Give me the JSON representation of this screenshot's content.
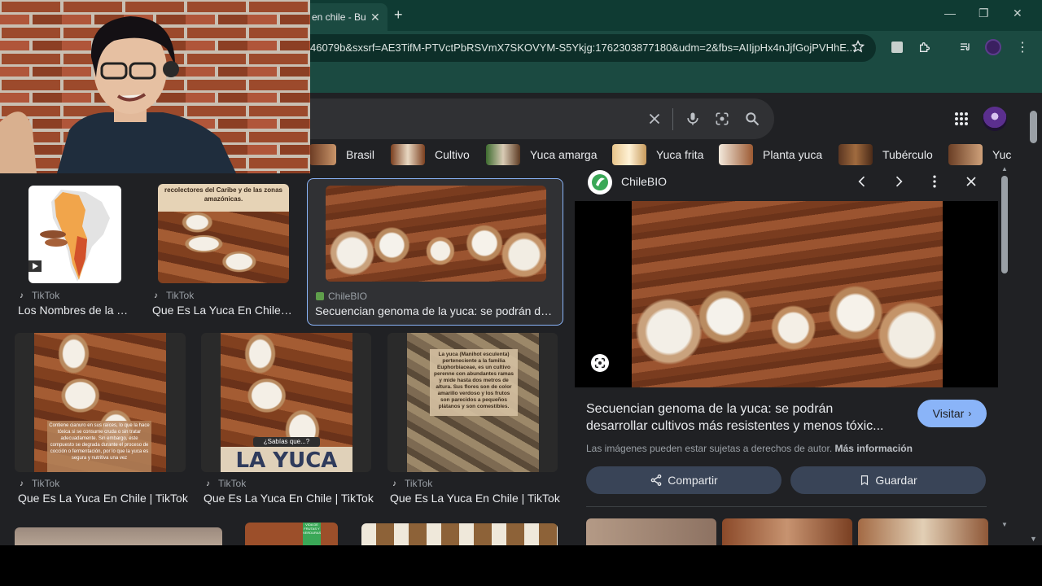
{
  "browser": {
    "tab_title": "en chile - Bu",
    "url": "46079b&sxsrf=AE3TifM-PTVctPbRSVmX7SKOVYM-S5Ykjg:1762303877180&udm=2&fbs=AIIjpHx4nJjfGojPVHhE..."
  },
  "chips": [
    {
      "label": "Brasil"
    },
    {
      "label": "Cultivo"
    },
    {
      "label": "Yuca amarga"
    },
    {
      "label": "Yuca frita"
    },
    {
      "label": "Planta yuca"
    },
    {
      "label": "Tubérculo"
    },
    {
      "label": "Yuc"
    }
  ],
  "results": [
    {
      "source": "TikTok",
      "title": "Los Nombres de la Y..."
    },
    {
      "source": "TikTok",
      "title": "Que Es La Yuca En Chile |..."
    },
    {
      "source": "ChileBIO",
      "title": "Secuencian genoma de la yuca: se podrán des..."
    },
    {
      "source": "TikTok",
      "title": "Que Es La Yuca En Chile | TikTok"
    },
    {
      "source": "TikTok",
      "title": "Que Es La Yuca En Chile | TikTok"
    },
    {
      "source": "TikTok",
      "title": "Que Es La Yuca En Chile | TikTok"
    }
  ],
  "image_text": {
    "caribe": "recolectores del Caribe y de las zonas amazónicas.",
    "sabias": "¿Sabías que...?",
    "la_yuca": "LA YUCA",
    "contiene": "Contiene cianuro en sus raíces, lo que la hace tóxica si se consume cruda o sin tratar adecuadamente. Sin embargo, este compuesto se degrada durante el proceso de cocción o fermentación, por lo que la yuca es segura y nutritiva una vez",
    "manihot": "La yuca (Manihot esculenta) perteneciente a la familia Euphorbiaceae, es un cultivo perenne con abundantes ramas y mide hasta dos metros de altura. Sus flores son de color amarillo verdoso y los frutos son parecidos a pequeños plátanos y son comestibles.",
    "verduras": "VIDA DE FRUTAS Y VERDURAS"
  },
  "panel": {
    "source": "ChileBIO",
    "title_line1": "Secuencian genoma de la yuca: se podrán",
    "title_line2": "desarrollar cultivos más resistentes y menos tóxic...",
    "visit_label": "Visitar",
    "copyright": "Las imágenes pueden estar sujetas a derechos de autor.",
    "more_info": "Más información",
    "share_label": "Compartir",
    "save_label": "Guardar"
  },
  "colors": {
    "page_bg": "#202124",
    "chrome_frame": "#1b4a41",
    "accent_button": "#8ab4f8",
    "action_button": "#394457"
  }
}
